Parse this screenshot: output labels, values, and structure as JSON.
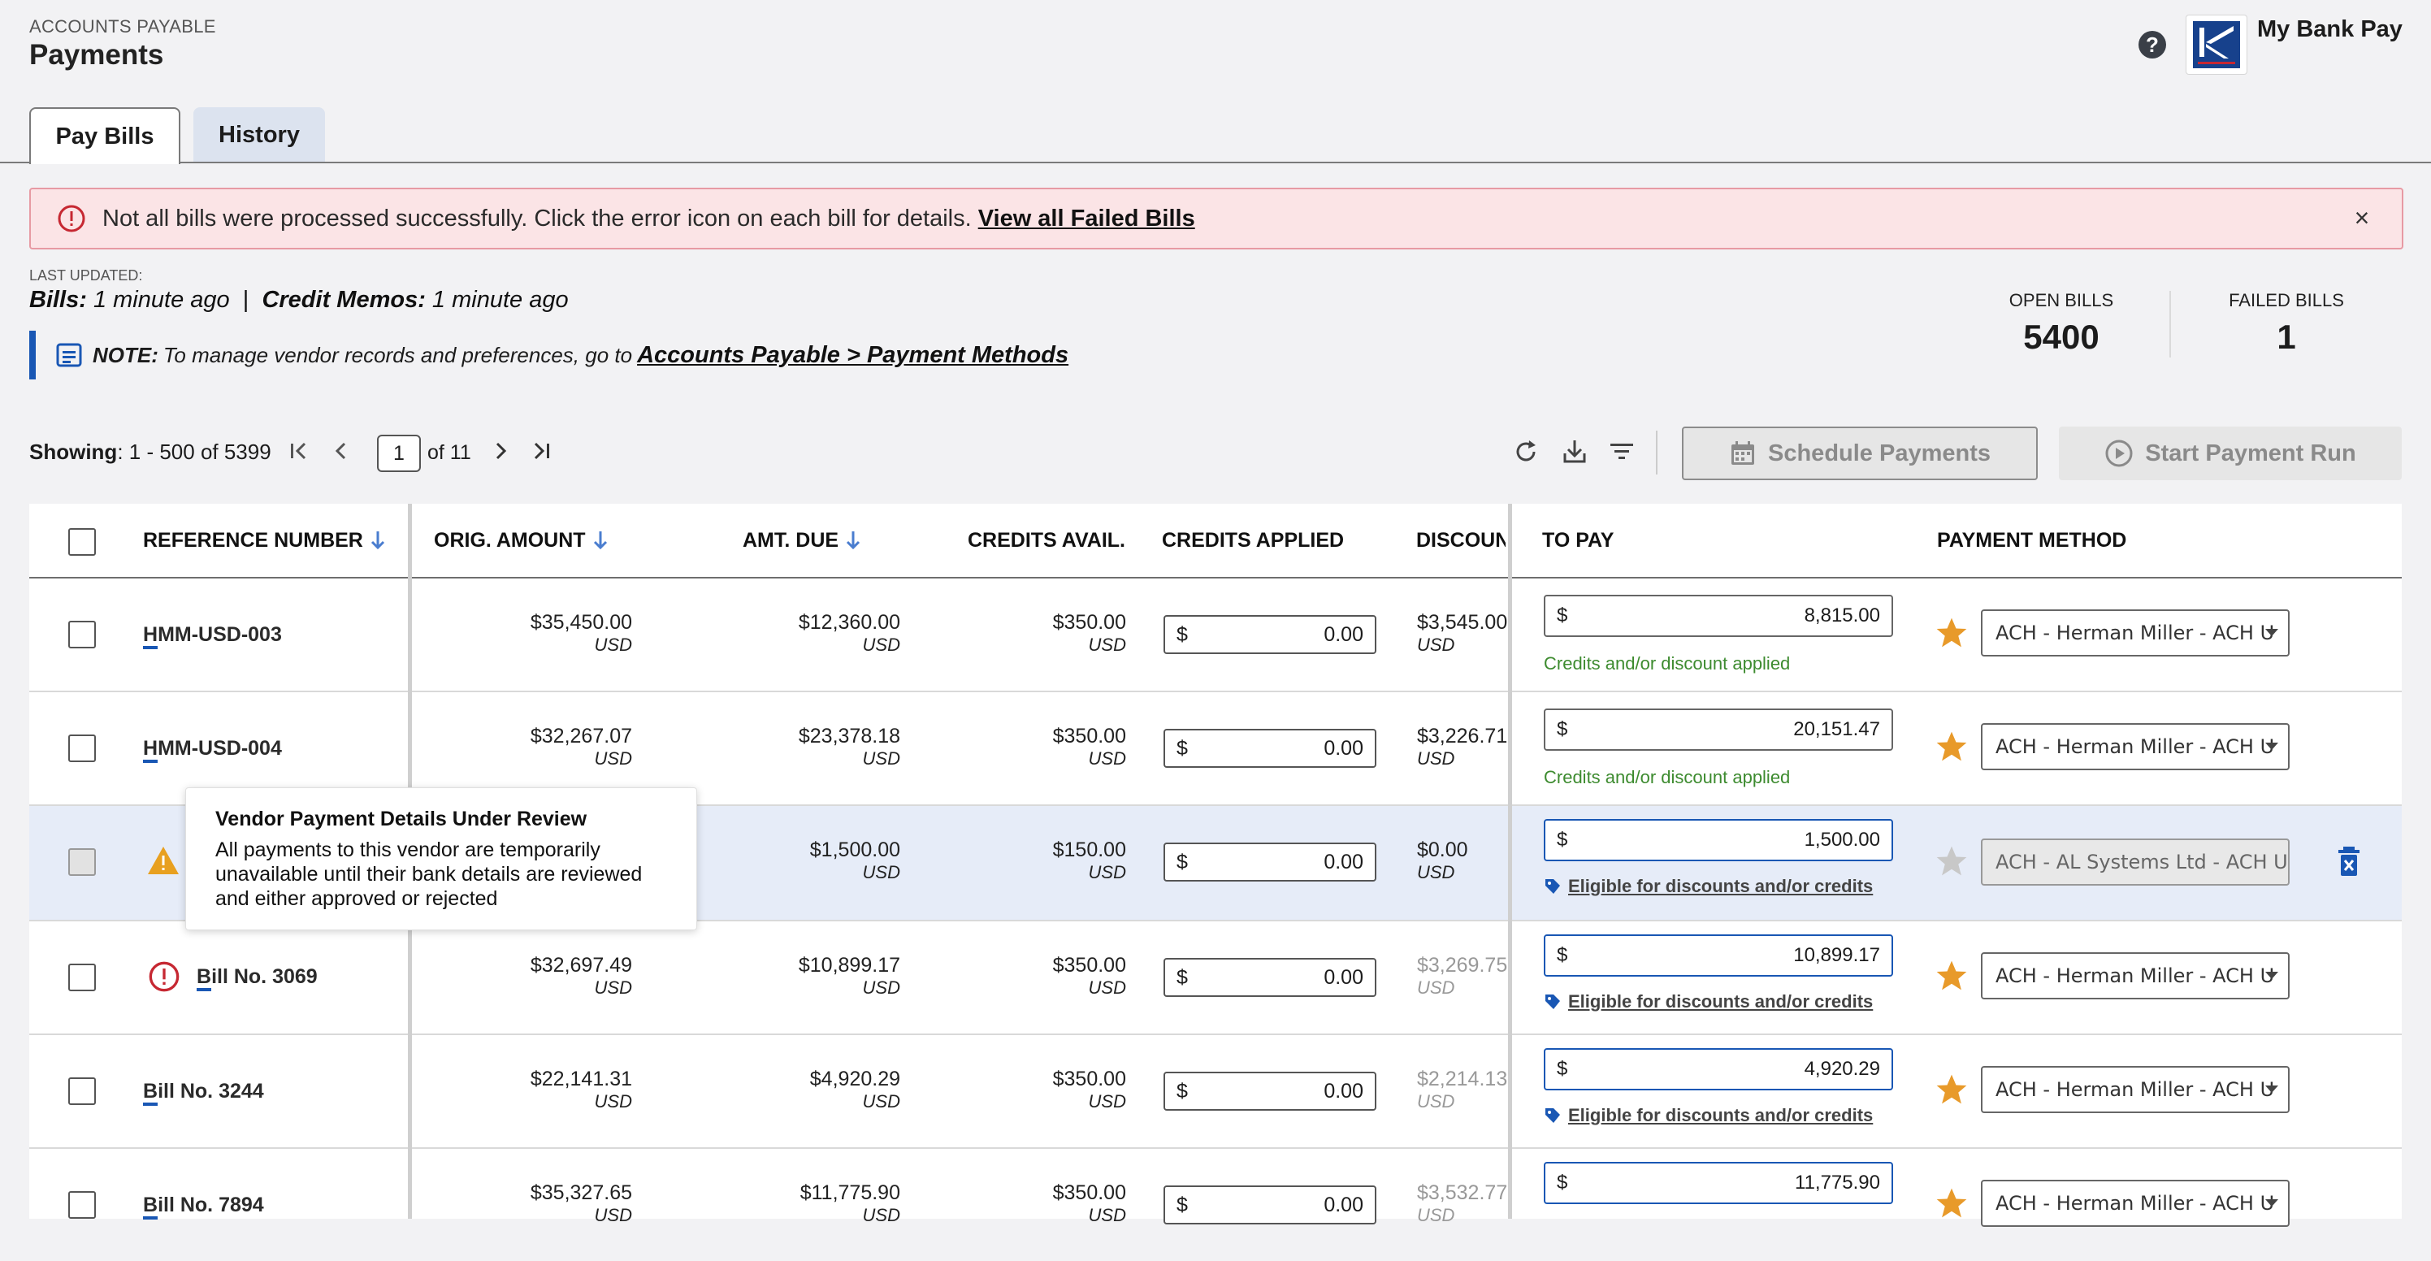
{
  "header": {
    "section": "ACCOUNTS PAYABLE",
    "title": "Payments",
    "bank_name": "My Bank Pay",
    "help_icon": "?"
  },
  "tabs": [
    {
      "label": "Pay Bills",
      "active": true
    },
    {
      "label": "History",
      "active": false
    }
  ],
  "banner": {
    "text": "Not all bills were processed successfully. Click the error icon on each bill for details.",
    "link": "View all Failed Bills",
    "close": "×"
  },
  "last_updated": {
    "label": "LAST UPDATED:",
    "bills_label": "Bills:",
    "bills_value": "1 minute ago",
    "sep": "|",
    "credits_label": "Credit Memos:",
    "credits_value": "1 minute ago"
  },
  "note": {
    "label": "NOTE:",
    "text": "To manage vendor records and preferences, go to",
    "link": "Accounts Payable > Payment Methods"
  },
  "stats": {
    "open_label": "OPEN BILLS",
    "open_value": "5400",
    "failed_label": "FAILED BILLS",
    "failed_value": "1"
  },
  "toolbar": {
    "showing_label": "Showing",
    "showing_range": ": 1 - 500 of 5399",
    "page": "1",
    "of_pages": "of 11",
    "schedule_label": "Schedule Payments",
    "start_label": "Start Payment Run"
  },
  "columns": {
    "reference": "REFERENCE NUMBER",
    "orig_amount": "ORIG. AMOUNT",
    "amt_due": "AMT. DUE",
    "credits_avail": "CREDITS AVAIL.",
    "credits_applied": "CREDITS APPLIED",
    "discount": "DISCOUN",
    "to_pay": "TO PAY",
    "payment_method": "PAYMENT METHOD"
  },
  "rows": [
    {
      "ref_first": "H",
      "ref_rest": "MM-USD-003",
      "orig": "$35,450.00",
      "due": "$12,360.00",
      "credits": "$350.00",
      "currency": "USD",
      "applied": "0.00",
      "discount": "$3,545.00",
      "to_pay": "8,815.00",
      "note": "Credits and/or discount applied",
      "method": "ACH - Herman Miller - ACH U"
    },
    {
      "ref_first": "H",
      "ref_rest": "MM-USD-004",
      "orig": "$32,267.07",
      "due": "$23,378.18",
      "credits": "$350.00",
      "currency": "USD",
      "applied": "0.00",
      "discount": "$3,226.71",
      "to_pay": "20,151.47",
      "note": "Credits and/or discount applied",
      "method": "ACH - Herman Miller - ACH U"
    },
    {
      "ref_first": "",
      "ref_rest": "",
      "orig": "",
      "due": "$1,500.00",
      "credits": "$150.00",
      "currency": "USD",
      "applied": "0.00",
      "discount": "$0.00",
      "to_pay": "1,500.00",
      "note": "Eligible for discounts and/or credits",
      "method": "ACH - AL Systems Ltd - ACH US"
    },
    {
      "ref_first": "B",
      "ref_rest": "ill No. 3069",
      "orig": "$32,697.49",
      "due": "$10,899.17",
      "credits": "$350.00",
      "currency": "USD",
      "applied": "0.00",
      "discount": "$3,269.75",
      "to_pay": "10,899.17",
      "note": "Eligible for discounts and/or credits",
      "method": "ACH - Herman Miller - ACH U"
    },
    {
      "ref_first": "B",
      "ref_rest": "ill No. 3244",
      "orig": "$22,141.31",
      "due": "$4,920.29",
      "credits": "$350.00",
      "currency": "USD",
      "applied": "0.00",
      "discount": "$2,214.13",
      "to_pay": "4,920.29",
      "note": "Eligible for discounts and/or credits",
      "method": "ACH - Herman Miller - ACH U"
    },
    {
      "ref_first": "B",
      "ref_rest": "ill No. 7894",
      "orig": "$35,327.65",
      "due": "$11,775.90",
      "credits": "$350.00",
      "currency": "USD",
      "applied": "0.00",
      "discount": "$3,532.77",
      "to_pay": "11,775.90",
      "note": "",
      "method": "ACH - Herman Miller - ACH U"
    }
  ],
  "dollar": "$",
  "tooltip": {
    "title": "Vendor Payment Details Under Review",
    "body": "All payments to this vendor are temporarily unavailable until their bank details are reviewed and either approved or rejected"
  },
  "colors": {
    "accent": "#1957b4",
    "error": "#c62832",
    "warning": "#e8a020",
    "star": "#e89a2a",
    "success": "#3d8b2f"
  }
}
